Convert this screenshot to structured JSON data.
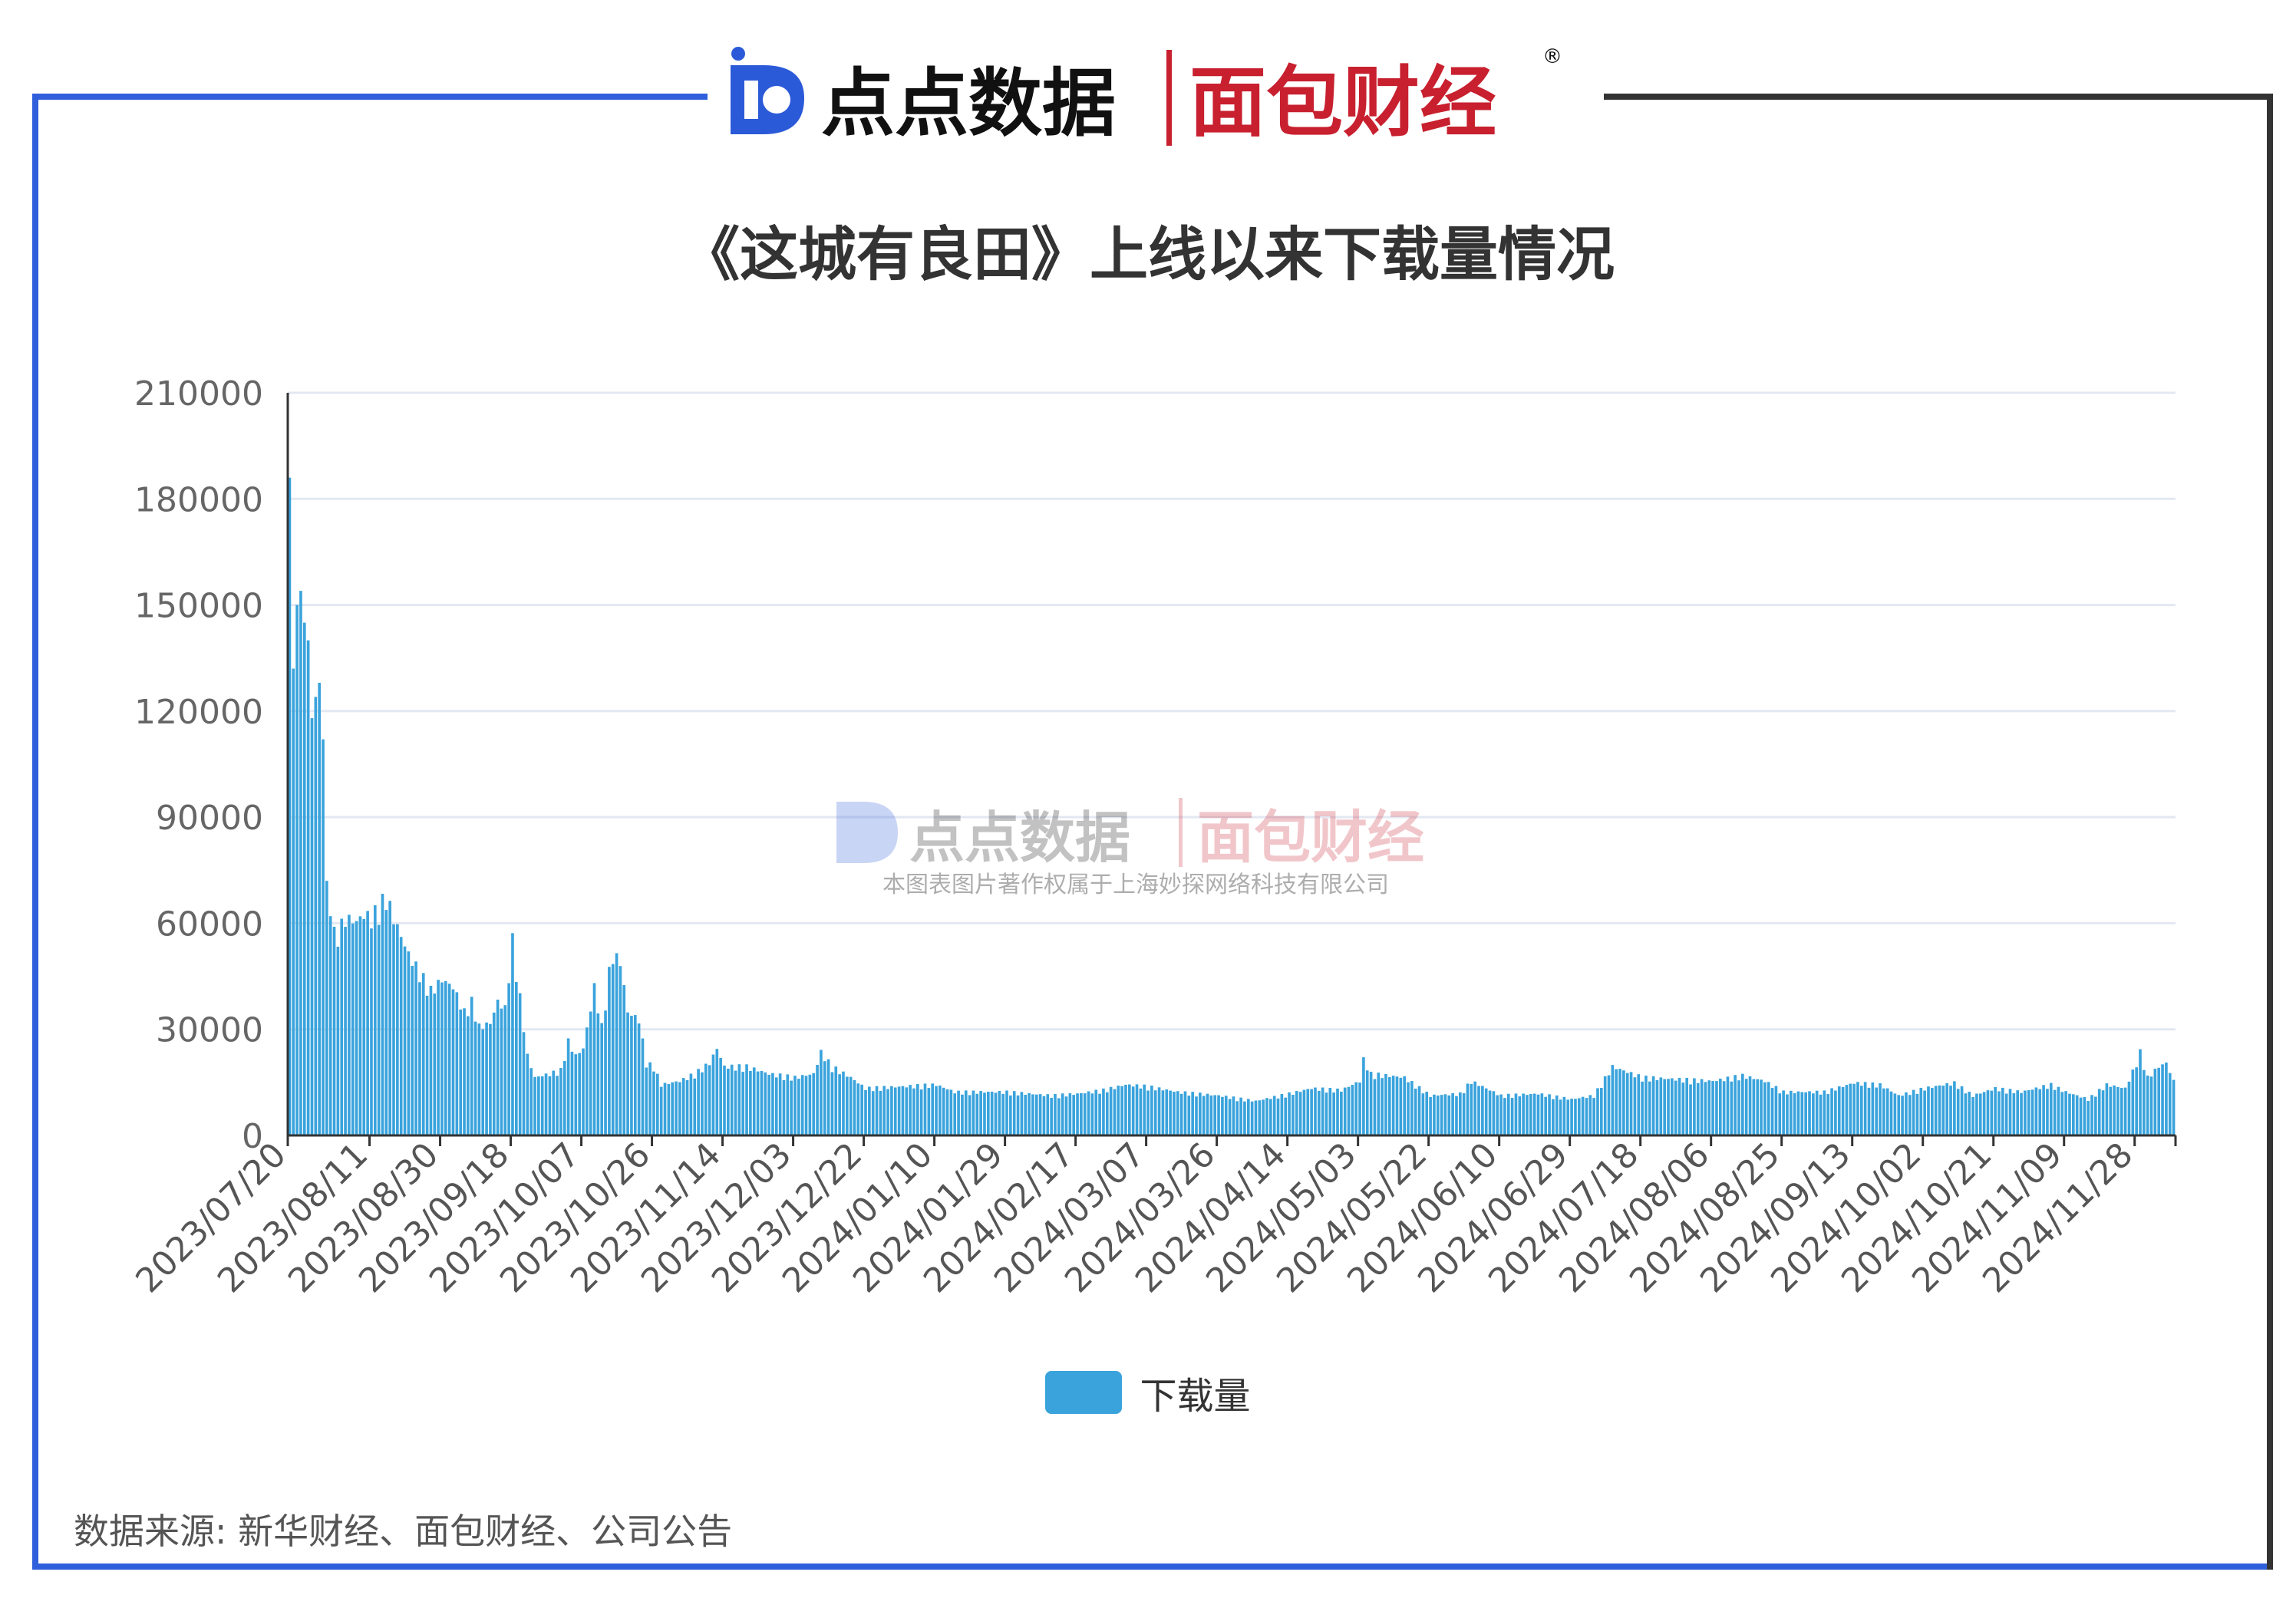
{
  "header": {
    "logo1_text": "点点数据",
    "logo2_text": "面包财经",
    "registered_mark": "®"
  },
  "watermark": {
    "logo1_text": "点点数据",
    "logo2_text": "面包财经",
    "copyright": "本图表图片著作权属于上海妙探网络科技有限公司"
  },
  "footer": {
    "source": "数据来源: 新华财经、面包财经、公司公告"
  },
  "colors": {
    "bar": "#3aa3dc",
    "frame_blue": "#2f5fdb",
    "grid": "#e3e8f2",
    "logo_blue": "#2b5ad8",
    "logo_red": "#c8202f"
  },
  "chart_data": {
    "type": "bar",
    "title": "《这城有良田》上线以来下载量情况",
    "legend": [
      "下载量"
    ],
    "legend_position": "bottom-center",
    "grid": true,
    "ylim": [
      0,
      210000
    ],
    "yticks": [
      0,
      30000,
      60000,
      90000,
      120000,
      150000,
      180000,
      210000
    ],
    "ytick_labels": [
      "0",
      "30000",
      "60000",
      "90000",
      "120000",
      "150000",
      "180000",
      "210000"
    ],
    "x_tick_labels": [
      "2023/07/20",
      "2023/08/11",
      "2023/08/30",
      "2023/09/18",
      "2023/10/07",
      "2023/10/26",
      "2023/11/14",
      "2023/12/03",
      "2023/12/22",
      "2024/01/10",
      "2024/01/29",
      "2024/02/17",
      "2024/03/07",
      "2024/03/26",
      "2024/04/14",
      "2024/05/03",
      "2024/05/22",
      "2024/06/10",
      "2024/06/29",
      "2024/07/18",
      "2024/08/06",
      "2024/08/25",
      "2024/09/13",
      "2024/10/02",
      "2024/10/21",
      "2024/11/09",
      "2024/11/28"
    ],
    "series": [
      {
        "name": "下载量",
        "start_date": "2023-07-20",
        "end_date": "2024-12-08",
        "keypoints": [
          [
            "2023-07-20",
            186000
          ],
          [
            "2023-07-21",
            132000
          ],
          [
            "2023-07-22",
            150000
          ],
          [
            "2023-07-23",
            154000
          ],
          [
            "2023-07-24",
            145000
          ],
          [
            "2023-07-25",
            140000
          ],
          [
            "2023-07-26",
            118000
          ],
          [
            "2023-07-27",
            124000
          ],
          [
            "2023-07-28",
            128000
          ],
          [
            "2023-07-29",
            112000
          ],
          [
            "2023-07-30",
            72000
          ],
          [
            "2023-07-31",
            62000
          ],
          [
            "2023-08-02",
            56000
          ],
          [
            "2023-08-04",
            60000
          ],
          [
            "2023-08-07",
            59000
          ],
          [
            "2023-08-09",
            61000
          ],
          [
            "2023-08-11",
            60000
          ],
          [
            "2023-08-13",
            63000
          ],
          [
            "2023-08-15",
            66000
          ],
          [
            "2023-08-17",
            60000
          ],
          [
            "2023-08-19",
            55000
          ],
          [
            "2023-08-21",
            50000
          ],
          [
            "2023-08-24",
            45000
          ],
          [
            "2023-08-27",
            40000
          ],
          [
            "2023-08-30",
            43000
          ],
          [
            "2023-09-02",
            41000
          ],
          [
            "2023-09-05",
            34000
          ],
          [
            "2023-09-07",
            37000
          ],
          [
            "2023-09-09",
            30000
          ],
          [
            "2023-09-12",
            31000
          ],
          [
            "2023-09-14",
            37000
          ],
          [
            "2023-09-16",
            35000
          ],
          [
            "2023-09-18",
            54000
          ],
          [
            "2023-09-20",
            38000
          ],
          [
            "2023-09-22",
            22000
          ],
          [
            "2023-09-24",
            16000
          ],
          [
            "2023-09-28",
            17000
          ],
          [
            "2023-10-01",
            18000
          ],
          [
            "2023-10-03",
            26000
          ],
          [
            "2023-10-05",
            22000
          ],
          [
            "2023-10-07",
            24000
          ],
          [
            "2023-10-09",
            35000
          ],
          [
            "2023-10-10",
            41000
          ],
          [
            "2023-10-12",
            30000
          ],
          [
            "2023-10-14",
            45000
          ],
          [
            "2023-10-15",
            50000
          ],
          [
            "2023-10-17",
            48000
          ],
          [
            "2023-10-19",
            34000
          ],
          [
            "2023-10-22",
            32000
          ],
          [
            "2023-10-24",
            20000
          ],
          [
            "2023-10-26",
            19000
          ],
          [
            "2023-10-28",
            14000
          ],
          [
            "2023-11-02",
            15000
          ],
          [
            "2023-11-06",
            17000
          ],
          [
            "2023-11-10",
            20000
          ],
          [
            "2023-11-12",
            24000
          ],
          [
            "2023-11-14",
            19000
          ],
          [
            "2023-11-20",
            19000
          ],
          [
            "2023-11-26",
            17000
          ],
          [
            "2023-12-03",
            16000
          ],
          [
            "2023-12-08",
            17000
          ],
          [
            "2023-12-10",
            23000
          ],
          [
            "2023-12-13",
            19000
          ],
          [
            "2023-12-18",
            16000
          ],
          [
            "2023-12-22",
            13000
          ],
          [
            "2024-01-01",
            13500
          ],
          [
            "2024-01-10",
            14000
          ],
          [
            "2024-01-15",
            12000
          ],
          [
            "2024-01-29",
            12000
          ],
          [
            "2024-02-10",
            11000
          ],
          [
            "2024-02-17",
            11500
          ],
          [
            "2024-02-24",
            12500
          ],
          [
            "2024-03-01",
            14000
          ],
          [
            "2024-03-07",
            13500
          ],
          [
            "2024-03-15",
            12000
          ],
          [
            "2024-03-26",
            11000
          ],
          [
            "2024-04-05",
            9500
          ],
          [
            "2024-04-14",
            11500
          ],
          [
            "2024-04-20",
            13000
          ],
          [
            "2024-04-28",
            12500
          ],
          [
            "2024-05-03",
            15000
          ],
          [
            "2024-05-04",
            21000
          ],
          [
            "2024-05-06",
            17000
          ],
          [
            "2024-05-15",
            16000
          ],
          [
            "2024-05-22",
            11000
          ],
          [
            "2024-05-30",
            11500
          ],
          [
            "2024-06-02",
            15000
          ],
          [
            "2024-06-10",
            11000
          ],
          [
            "2024-06-20",
            11500
          ],
          [
            "2024-06-29",
            10000
          ],
          [
            "2024-07-05",
            11000
          ],
          [
            "2024-07-10",
            19000
          ],
          [
            "2024-07-18",
            16000
          ],
          [
            "2024-08-06",
            15000
          ],
          [
            "2024-08-14",
            16500
          ],
          [
            "2024-08-20",
            15000
          ],
          [
            "2024-08-25",
            12000
          ],
          [
            "2024-09-05",
            12000
          ],
          [
            "2024-09-13",
            14500
          ],
          [
            "2024-09-20",
            14000
          ],
          [
            "2024-09-25",
            11000
          ],
          [
            "2024-10-02",
            13000
          ],
          [
            "2024-10-10",
            14500
          ],
          [
            "2024-10-15",
            11000
          ],
          [
            "2024-10-21",
            13000
          ],
          [
            "2024-10-28",
            12000
          ],
          [
            "2024-11-05",
            14000
          ],
          [
            "2024-11-09",
            12000
          ],
          [
            "2024-11-15",
            10000
          ],
          [
            "2024-11-20",
            14000
          ],
          [
            "2024-11-25",
            13000
          ],
          [
            "2024-11-28",
            20000
          ],
          [
            "2024-11-29",
            23000
          ],
          [
            "2024-12-01",
            16000
          ],
          [
            "2024-12-04",
            19000
          ],
          [
            "2024-12-06",
            20000
          ],
          [
            "2024-12-08",
            15000
          ]
        ]
      }
    ]
  }
}
